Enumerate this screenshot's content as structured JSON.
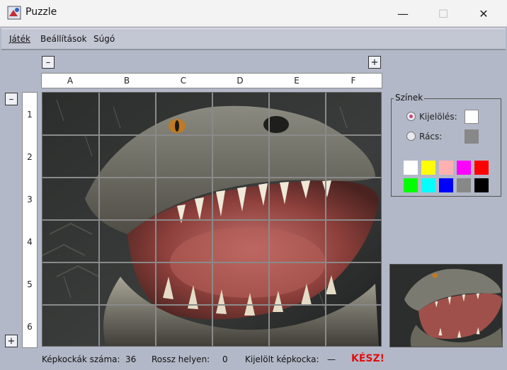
{
  "window": {
    "title": "Puzzle",
    "minimize_glyph": "—",
    "maximize_glyph": "☐",
    "close_glyph": "✕"
  },
  "menu": {
    "items": [
      {
        "label": "Játék"
      },
      {
        "label": "Beállítások"
      },
      {
        "label": "Súgó"
      }
    ]
  },
  "zoom": {
    "col_minus": "–",
    "col_plus": "+",
    "row_minus": "–",
    "row_plus": "+"
  },
  "board": {
    "columns": [
      "A",
      "B",
      "C",
      "D",
      "E",
      "F"
    ],
    "rows": [
      "1",
      "2",
      "3",
      "4",
      "5",
      "6"
    ],
    "grid_color": "#888888"
  },
  "colors_panel": {
    "title": "Színek",
    "selection_label": "Kijelölés:",
    "selection_color": "#ffffff",
    "selection_checked": true,
    "grid_label": "Rács:",
    "grid_color": "#888888",
    "grid_checked": false,
    "palette": [
      "#ffffff",
      "#ffff00",
      "#ffb0b0",
      "#ff00ff",
      "#ff0000",
      "#00ff00",
      "#00ffff",
      "#0000ff",
      "#888888",
      "#000000"
    ]
  },
  "status": {
    "pieces_label": "Képkockák száma:",
    "pieces_value": "36",
    "wrong_label": "Rossz helyen:",
    "wrong_value": "0",
    "selected_label": "Kijelölt képkocka:",
    "selected_value": "—",
    "done_label": "KÉSZ!"
  }
}
